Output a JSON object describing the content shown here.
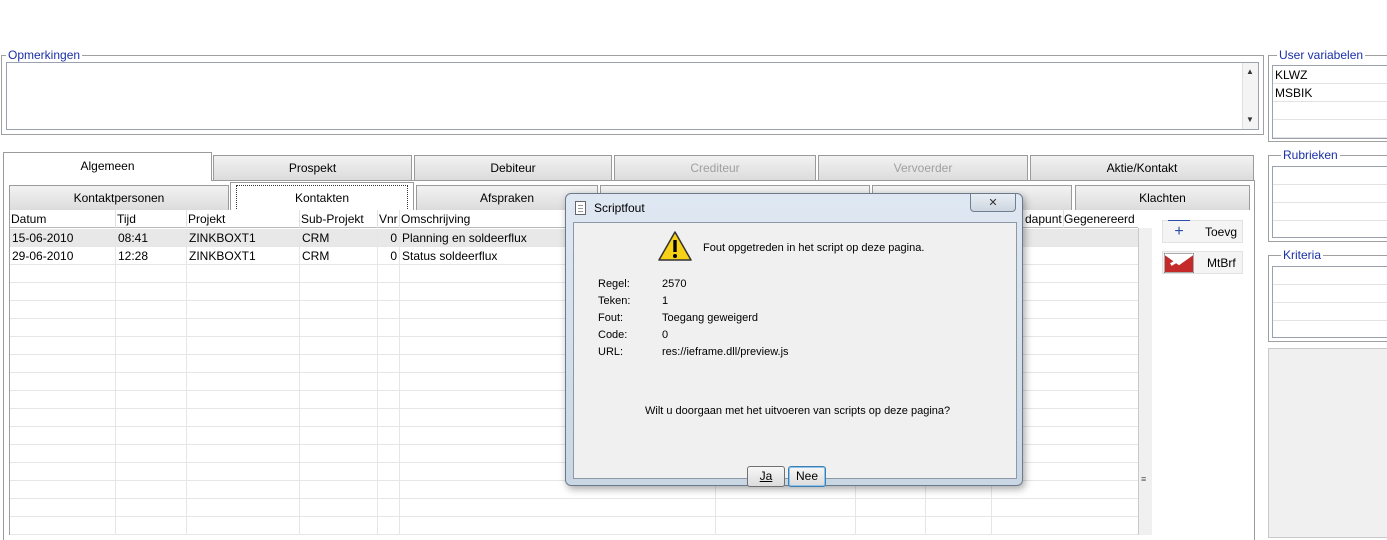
{
  "opmerkingen": {
    "legend": "Opmerkingen",
    "value": ""
  },
  "user_variabelen": {
    "legend": "User variabelen",
    "items": [
      "KLWZ",
      "MSBIK",
      "",
      ""
    ]
  },
  "rubrieken": {
    "legend": "Rubrieken"
  },
  "kriteria": {
    "legend": "Kriteria"
  },
  "tabs_main": [
    {
      "label": "Algemeen",
      "state": "active"
    },
    {
      "label": "Prospekt",
      "state": "normal"
    },
    {
      "label": "Debiteur",
      "state": "normal"
    },
    {
      "label": "Crediteur",
      "state": "disabled"
    },
    {
      "label": "Vervoerder",
      "state": "disabled"
    },
    {
      "label": "Aktie/Kontakt",
      "state": "normal"
    }
  ],
  "tabs_sub": [
    {
      "label": "Kontaktpersonen"
    },
    {
      "label": "Kontakten"
    },
    {
      "label": "Afspraken"
    },
    {
      "label": "Klachten"
    }
  ],
  "grid": {
    "columns": [
      "Datum",
      "Tijd",
      "Projekt",
      "Sub-Projekt",
      "Vnr",
      "Omschrijving",
      "dapunt",
      "Gegenereerd"
    ],
    "rows": [
      {
        "datum": "15-06-2010",
        "tijd": "08:41",
        "projekt": "ZINKBOXT1",
        "sub": "CRM",
        "vnr": "0",
        "omschr": "Planning en soldeerflux"
      },
      {
        "datum": "29-06-2010",
        "tijd": "12:28",
        "projekt": "ZINKBOXT1",
        "sub": "CRM",
        "vnr": "0",
        "omschr": "Status soldeerflux"
      }
    ]
  },
  "side_buttons": [
    {
      "label": "Toevg",
      "icon": "plus-icon"
    },
    {
      "label": "MtBrf",
      "icon": "letter-icon"
    }
  ],
  "dialog": {
    "title": "Scriptfout",
    "message": "Fout opgetreden in het script op deze pagina.",
    "labels": {
      "regel": "Regel:",
      "teken": "Teken:",
      "fout": "Fout:",
      "code": "Code:",
      "url": "URL:"
    },
    "values": {
      "regel": "2570",
      "teken": "1",
      "fout": "Toegang geweigerd",
      "code": "0",
      "url": "res://ieframe.dll/preview.js"
    },
    "question": "Wilt u doorgaan met het uitvoeren van scripts op deze pagina?",
    "yes_label": "Ja",
    "no_label": "Nee",
    "close_glyph": "✕"
  }
}
